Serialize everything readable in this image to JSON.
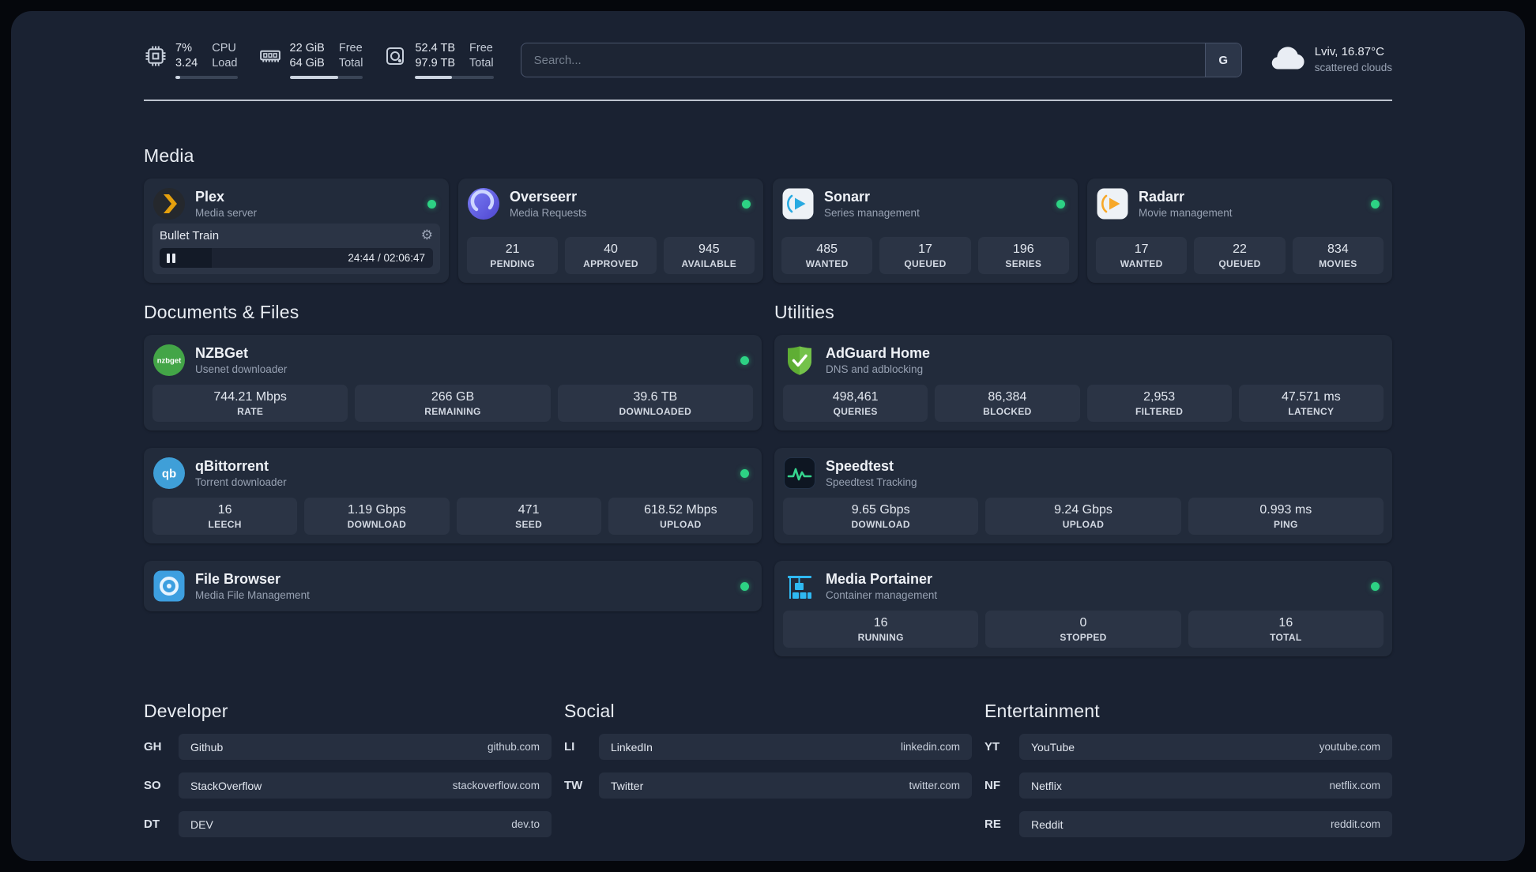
{
  "colors": {
    "status_online": "#2dd284",
    "plex_gold": "#e5a00d",
    "sonarr_blue": "#29aae1",
    "radarr_amber": "#f7a829",
    "adguard_green": "#5fae34",
    "speedtest_green": "#36d58e",
    "portainer_blue": "#2fb9f2"
  },
  "icons": {
    "gear": "⚙"
  },
  "topbar": {
    "cpu": {
      "icon": "cpu-chip-icon",
      "usage": "7%",
      "load": "3.24",
      "label_line1": "CPU",
      "label_line2": "Load",
      "bar_fill": "8%"
    },
    "memory": {
      "icon": "memory-icon",
      "free": "22 GiB",
      "total": "64 GiB",
      "free_label": "Free",
      "total_label": "Total",
      "bar_fill": "66%"
    },
    "disk": {
      "icon": "hard-disk-icon",
      "free": "52.4 TB",
      "total": "97.9 TB",
      "free_label": "Free",
      "total_label": "Total",
      "bar_fill": "47%"
    },
    "search": {
      "placeholder": "Search...",
      "provider_button": "G"
    },
    "weather": {
      "icon": "cloud-icon",
      "location_temp": "Lviv, 16.87°C",
      "condition": "scattered clouds"
    }
  },
  "sections": {
    "media": {
      "title": "Media",
      "plex": {
        "name": "Plex",
        "subtitle": "Media server",
        "status": "online",
        "now_playing": {
          "title": "Bullet Train",
          "time": "24:44 / 02:06:47",
          "progress": "19%"
        }
      },
      "overseerr": {
        "name": "Overseerr",
        "subtitle": "Media Requests",
        "status": "online",
        "stats": [
          {
            "value": "21",
            "label": "PENDING"
          },
          {
            "value": "40",
            "label": "APPROVED"
          },
          {
            "value": "945",
            "label": "AVAILABLE"
          }
        ]
      },
      "sonarr": {
        "name": "Sonarr",
        "subtitle": "Series management",
        "status": "online",
        "stats": [
          {
            "value": "485",
            "label": "WANTED"
          },
          {
            "value": "17",
            "label": "QUEUED"
          },
          {
            "value": "196",
            "label": "SERIES"
          }
        ]
      },
      "radarr": {
        "name": "Radarr",
        "subtitle": "Movie management",
        "status": "online",
        "stats": [
          {
            "value": "17",
            "label": "WANTED"
          },
          {
            "value": "22",
            "label": "QUEUED"
          },
          {
            "value": "834",
            "label": "MOVIES"
          }
        ]
      }
    },
    "documents": {
      "title": "Documents & Files",
      "nzbget": {
        "name": "NZBGet",
        "subtitle": "Usenet downloader",
        "status": "online",
        "icon_text": "nzbget",
        "stats": [
          {
            "value": "744.21 Mbps",
            "label": "RATE"
          },
          {
            "value": "266 GB",
            "label": "REMAINING"
          },
          {
            "value": "39.6 TB",
            "label": "DOWNLOADED"
          }
        ]
      },
      "qbittorrent": {
        "name": "qBittorrent",
        "subtitle": "Torrent downloader",
        "status": "online",
        "icon_text": "qb",
        "stats": [
          {
            "value": "16",
            "label": "LEECH"
          },
          {
            "value": "1.19 Gbps",
            "label": "DOWNLOAD"
          },
          {
            "value": "471",
            "label": "SEED"
          },
          {
            "value": "618.52 Mbps",
            "label": "UPLOAD"
          }
        ]
      },
      "filebrowser": {
        "name": "File Browser",
        "subtitle": "Media File Management",
        "status": "online"
      }
    },
    "utilities": {
      "title": "Utilities",
      "adguard": {
        "name": "AdGuard Home",
        "subtitle": "DNS and adblocking",
        "stats": [
          {
            "value": "498,461",
            "label": "QUERIES"
          },
          {
            "value": "86,384",
            "label": "BLOCKED"
          },
          {
            "value": "2,953",
            "label": "FILTERED"
          },
          {
            "value": "47.571 ms",
            "label": "LATENCY"
          }
        ]
      },
      "speedtest": {
        "name": "Speedtest",
        "subtitle": "Speedtest Tracking",
        "stats": [
          {
            "value": "9.65 Gbps",
            "label": "DOWNLOAD"
          },
          {
            "value": "9.24 Gbps",
            "label": "UPLOAD"
          },
          {
            "value": "0.993 ms",
            "label": "PING"
          }
        ]
      },
      "portainer": {
        "name": "Media Portainer",
        "subtitle": "Container management",
        "status": "online",
        "stats": [
          {
            "value": "16",
            "label": "RUNNING"
          },
          {
            "value": "0",
            "label": "STOPPED"
          },
          {
            "value": "16",
            "label": "TOTAL"
          }
        ]
      }
    },
    "bookmarks": [
      {
        "title": "Developer",
        "links": [
          {
            "abbr": "GH",
            "name": "Github",
            "url": "github.com"
          },
          {
            "abbr": "SO",
            "name": "StackOverflow",
            "url": "stackoverflow.com"
          },
          {
            "abbr": "DT",
            "name": "DEV",
            "url": "dev.to"
          }
        ]
      },
      {
        "title": "Social",
        "links": [
          {
            "abbr": "LI",
            "name": "LinkedIn",
            "url": "linkedin.com"
          },
          {
            "abbr": "TW",
            "name": "Twitter",
            "url": "twitter.com"
          }
        ]
      },
      {
        "title": "Entertainment",
        "links": [
          {
            "abbr": "YT",
            "name": "YouTube",
            "url": "youtube.com"
          },
          {
            "abbr": "NF",
            "name": "Netflix",
            "url": "netflix.com"
          },
          {
            "abbr": "RE",
            "name": "Reddit",
            "url": "reddit.com"
          }
        ]
      }
    ]
  }
}
